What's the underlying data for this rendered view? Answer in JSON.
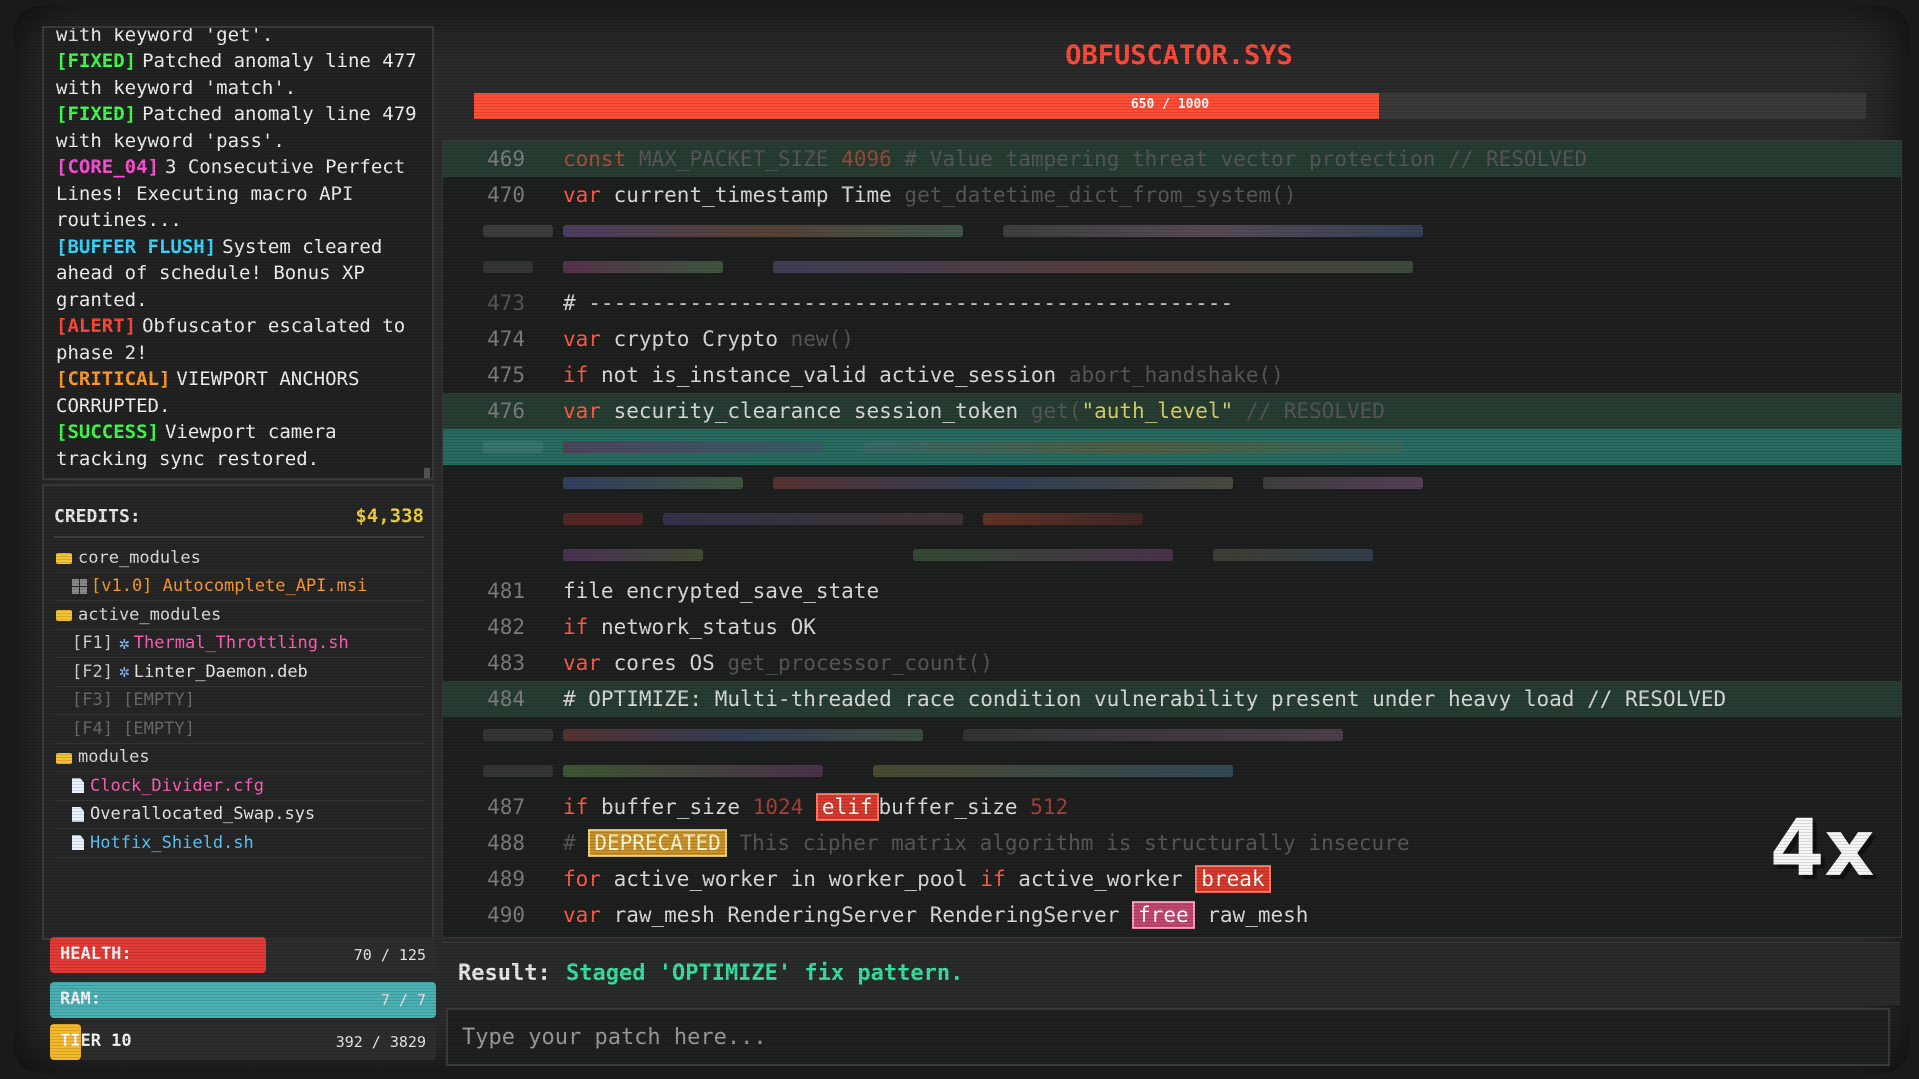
{
  "log": [
    {
      "tag": "",
      "tag_color": "",
      "text": "with keyword 'get'."
    },
    {
      "tag": "[FIXED]",
      "tag_color": "#3bff4a",
      "text": "Patched anomaly line 477 with keyword 'match'."
    },
    {
      "tag": "[FIXED]",
      "tag_color": "#3bff4a",
      "text": "Patched anomaly line 479 with keyword 'pass'."
    },
    {
      "tag": "[CORE_04]",
      "tag_color": "#ff4fd8",
      "text": "3 Consecutive Perfect Lines! Executing macro API routines..."
    },
    {
      "tag": "[BUFFER FLUSH]",
      "tag_color": "#35d6ff",
      "text": "System cleared ahead of schedule! Bonus XP granted."
    },
    {
      "tag": "[ALERT]",
      "tag_color": "#ff4a3a",
      "text": "Obfuscator escalated to phase 2!"
    },
    {
      "tag": "[CRITICAL]",
      "tag_color": "#ff9a2a",
      "text": "VIEWPORT ANCHORS CORRUPTED."
    },
    {
      "tag": "[SUCCESS]",
      "tag_color": "#3bff4a",
      "text": "Viewport camera tracking sync restored."
    }
  ],
  "credits": {
    "label": "CREDITS:",
    "value": "$4,338"
  },
  "tree": {
    "core_modules": "core_modules",
    "autocomplete": "[v1.0] Autocomplete_API.msi",
    "active_modules": "active_modules",
    "f1_key": "[F1]",
    "f1_name": "Thermal_Throttling.sh",
    "f2_key": "[F2]",
    "f2_name": "Linter_Daemon.deb",
    "f3": "[F3] [EMPTY]",
    "f4": "[F4] [EMPTY]",
    "modules": "modules",
    "file1": "Clock_Divider.cfg",
    "file2": "Overallocated_Swap.sys",
    "file3": "Hotfix_Shield.sh",
    "colors": {
      "orange": "#ff9a2a",
      "pink": "#ff5fb8",
      "blue": "#59c7ff",
      "white": "#e8e8e8"
    }
  },
  "stats": {
    "health": {
      "label": "HEALTH:",
      "value": "70 / 125",
      "fraction": 0.56,
      "color": "#e33a35"
    },
    "ram": {
      "label": "RAM:",
      "value": "7 / 7",
      "fraction": 1.0,
      "color": "#4bb0b4"
    },
    "tier": {
      "label": "TIER 10",
      "value": "392 / 3829",
      "fraction": 0.08,
      "color": "#f3b82c"
    }
  },
  "title": "OBFUSCATOR.SYS",
  "progress": {
    "text": "650 / 1000",
    "fraction": 0.65
  },
  "code": {
    "l469": {
      "num": "469",
      "kw": "const",
      "a": "MAX_PACKET_SIZE",
      "b": "4096",
      "c": "# Value tampering threat vector protection // RESOLVED"
    },
    "l470": {
      "num": "470",
      "kw": "var",
      "a": "current_timestamp",
      "b": "Time",
      "c": "get_datetime_dict_from_system()"
    },
    "l473": {
      "num": "473",
      "a": "# ---------------------------------------------------"
    },
    "l474": {
      "num": "474",
      "kw": "var",
      "a": "crypto",
      "b": "Crypto",
      "c": "new()"
    },
    "l475": {
      "num": "475",
      "kw": "if",
      "a": "not",
      "b": "is_instance_valid",
      "c": "active_session",
      "d": "abort_handshake()"
    },
    "l476": {
      "num": "476",
      "kw": "var",
      "a": "security_clearance",
      "b": "session_token",
      "c": "get(",
      "d": "\"auth_level\"",
      "e": "// RESOLVED"
    },
    "l481": {
      "num": "481",
      "kw": "file",
      "a": "encrypted_save_state"
    },
    "l482": {
      "num": "482",
      "kw": "if",
      "a": "network_status",
      "b": "OK"
    },
    "l483": {
      "num": "483",
      "kw": "var",
      "a": "cores",
      "b": "OS",
      "c": "get_processor_count()"
    },
    "l484": {
      "num": "484",
      "a": "# OPTIMIZE: Multi-threaded race condition vulnerability present under heavy load // RESOLVED"
    },
    "l487": {
      "num": "487",
      "kw": "if",
      "a": "buffer_size",
      "b": "1024",
      "badge": "elif",
      "c": "buffer_size",
      "d": "512"
    },
    "l488": {
      "num": "488",
      "a": "#",
      "badge": "DEPRECATED",
      "b": "This cipher matrix algorithm is structurally insecure"
    },
    "l489": {
      "num": "489",
      "kw": "for",
      "a": "active_worker",
      "b": "in",
      "c": "worker_pool",
      "kw2": "if",
      "d": "active_worker",
      "badge": "break"
    },
    "l490": {
      "num": "490",
      "kw": "var",
      "a": "raw_mesh",
      "b": "RenderingServer",
      "c": "RenderingServer",
      "badge": "free",
      "d": "raw_mesh"
    }
  },
  "multiplier": "4x",
  "result": {
    "label": "Result:",
    "text": "Staged 'OPTIMIZE' fix pattern."
  },
  "input": {
    "placeholder": "Type your patch here..."
  }
}
